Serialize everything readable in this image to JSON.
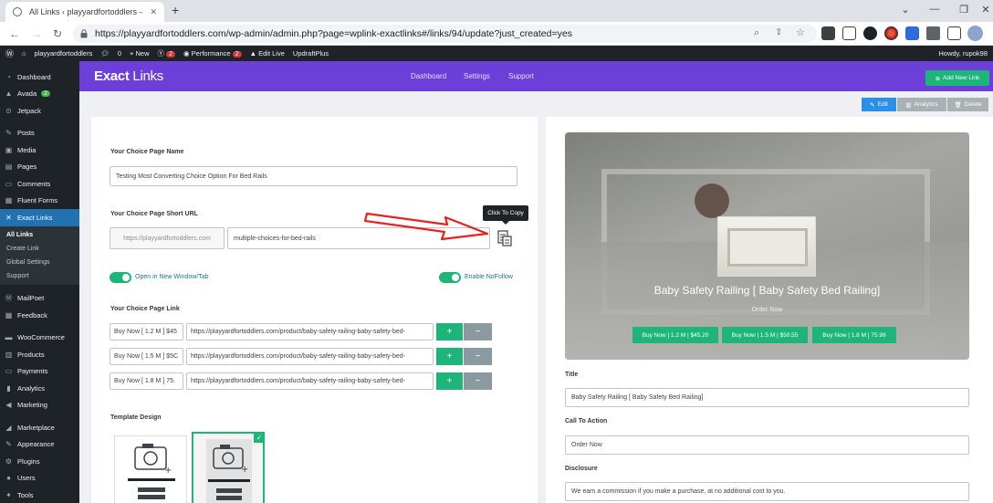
{
  "browser": {
    "tab_title": "All Links ‹ playyardfortoddlers —",
    "url": "https://playyardfortoddlers.com/wp-admin/admin.php?page=wplink-exactlinks#/links/94/update?just_created=yes"
  },
  "adminbar": {
    "site": "playyardfortoddlers",
    "comments": "0",
    "new": "New",
    "yoast_count": "2",
    "performance": "Performance",
    "performance_count": "2",
    "edit_live": "Edit Live",
    "updraft": "UpdraftPlus",
    "howdy": "Howdy, rupok98"
  },
  "sidebar": {
    "dashboard": "Dashboard",
    "avada": "Avada",
    "avada_badge": "2",
    "jetpack": "Jetpack",
    "posts": "Posts",
    "media": "Media",
    "pages": "Pages",
    "comments": "Comments",
    "fluent_forms": "Fluent Forms",
    "exact_links": "Exact Links",
    "sub_all_links": "All Links",
    "sub_create_link": "Create Link",
    "sub_global_settings": "Global Settings",
    "sub_support": "Support",
    "mailpoet": "MailPoet",
    "feedback": "Feedback",
    "woocommerce": "WooCommerce",
    "products": "Products",
    "payments": "Payments",
    "analytics": "Analytics",
    "marketing": "Marketing",
    "marketplace": "Marketplace",
    "appearance": "Appearance",
    "plugins": "Plugins",
    "users": "Users",
    "tools": "Tools"
  },
  "header": {
    "logo_bold": "Exact",
    "logo_rest": " Links",
    "nav_dashboard": "Dashboard",
    "nav_settings": "Settings",
    "nav_support": "Support",
    "add_new": "Add New Link"
  },
  "actions": {
    "edit": "Edit",
    "analytics": "Analytics",
    "delete": "Delete"
  },
  "form": {
    "page_name_label": "Your Choice Page Name",
    "page_name_value": "Testing Most Converting Choice Option For Bed Rails",
    "short_url_label": "Your Choice Page Short URL",
    "short_url_prefix": "https://playyardfortoddlers.com",
    "short_url_slug": "multiple-choices-for-bed-rails",
    "tooltip": "Click To Copy",
    "new_window_label": "Open in New Window/Tab",
    "nofollow_label": "Enable NoFollow",
    "page_link_label": "Your Choice Page Link",
    "links": [
      {
        "label": "Buy Now [ 1.2 M ] $45",
        "url": "https://playyardfortoddlers.com/product/baby-safety-railing-baby-safety-bed-"
      },
      {
        "label": "Buy Now [ 1.5 M ] $5C",
        "url": "https://playyardfortoddlers.com/product/baby-safety-railing-baby-safety-bed-"
      },
      {
        "label": "Buy Now [ 1.8 M ] 75.",
        "url": "https://playyardfortoddlers.com/product/baby-safety-railing-baby-safety-bed-"
      }
    ],
    "template_label": "Template Design"
  },
  "preview": {
    "title": "Baby Safety Railing [ Baby Safety Bed Railing]",
    "order": "Order Now",
    "buttons": [
      "Buy Now | 1.2 M | $45.20",
      "Buy Now | 1.5 M | $50.55",
      "Buy Now | 1.8 M | 75.99"
    ]
  },
  "details": {
    "title_label": "Title",
    "title_value": "Baby Safety Railing [ Baby Safety Bed Railing]",
    "cta_label": "Call To Action",
    "cta_value": "Order Now",
    "disclosure_label": "Disclosure",
    "disclosure_value": "We earn a commission if you make a purchase, at no additional cost to you."
  },
  "colors": {
    "brand": "#6b3fd8",
    "accent": "#1db57a",
    "wp_dark": "#1d2327",
    "wp_blue": "#2271b1"
  }
}
